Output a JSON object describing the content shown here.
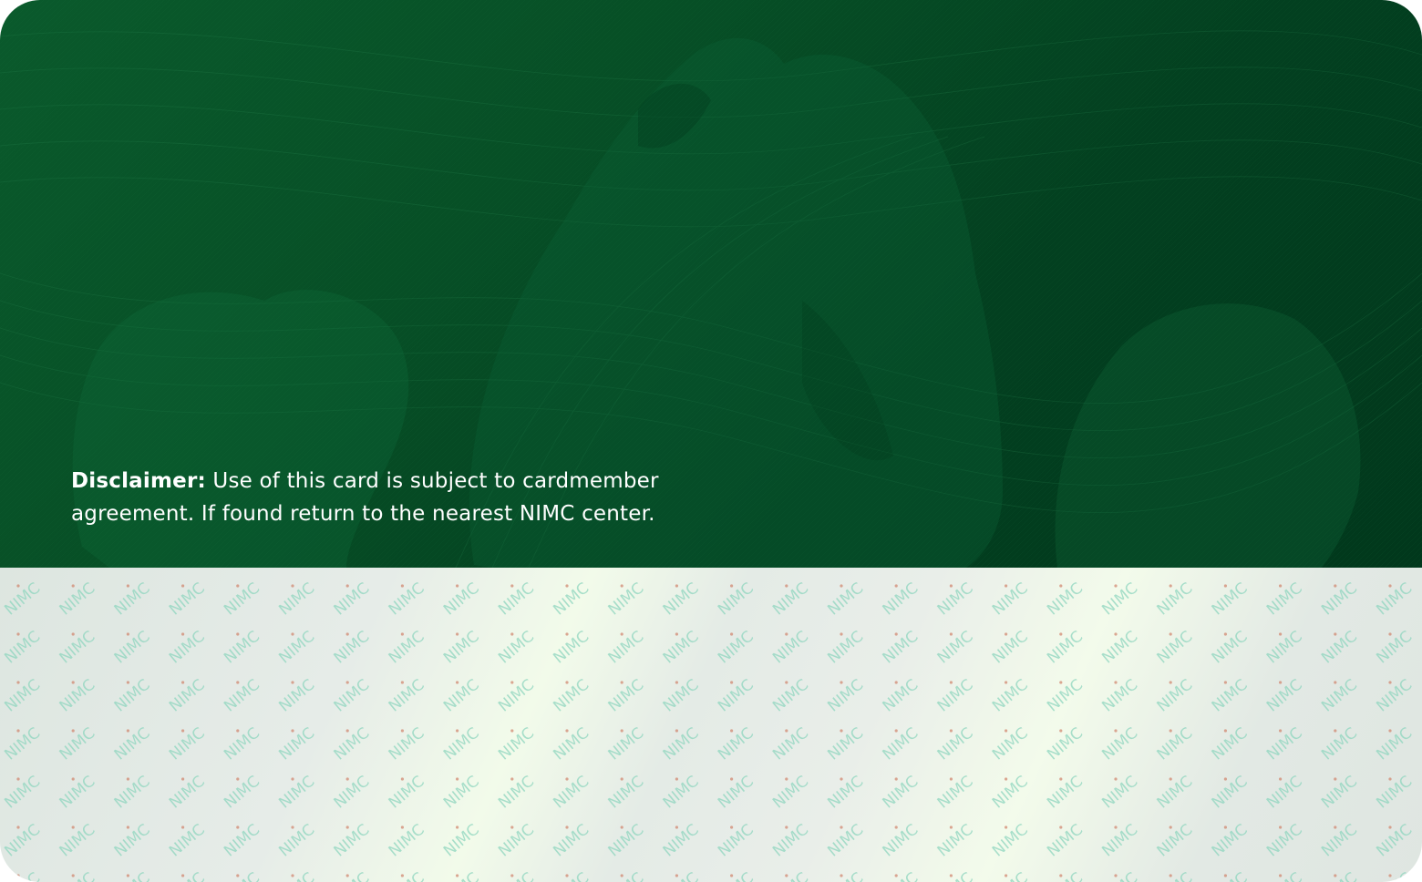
{
  "card": {
    "disclaimer_label": "Disclaimer:",
    "disclaimer_text": " Use of this card is subject to cardmember agreement. If found return to the nearest NIMC center.",
    "watermark_text": "NIMC",
    "colors": {
      "top_panel": "#034020",
      "bottom_panel": "#e6ece8",
      "watermark": "#8fd6bf",
      "text": "#ffffff"
    },
    "icons": {
      "coat_of_arms": "coat-of-arms-watermark"
    }
  }
}
